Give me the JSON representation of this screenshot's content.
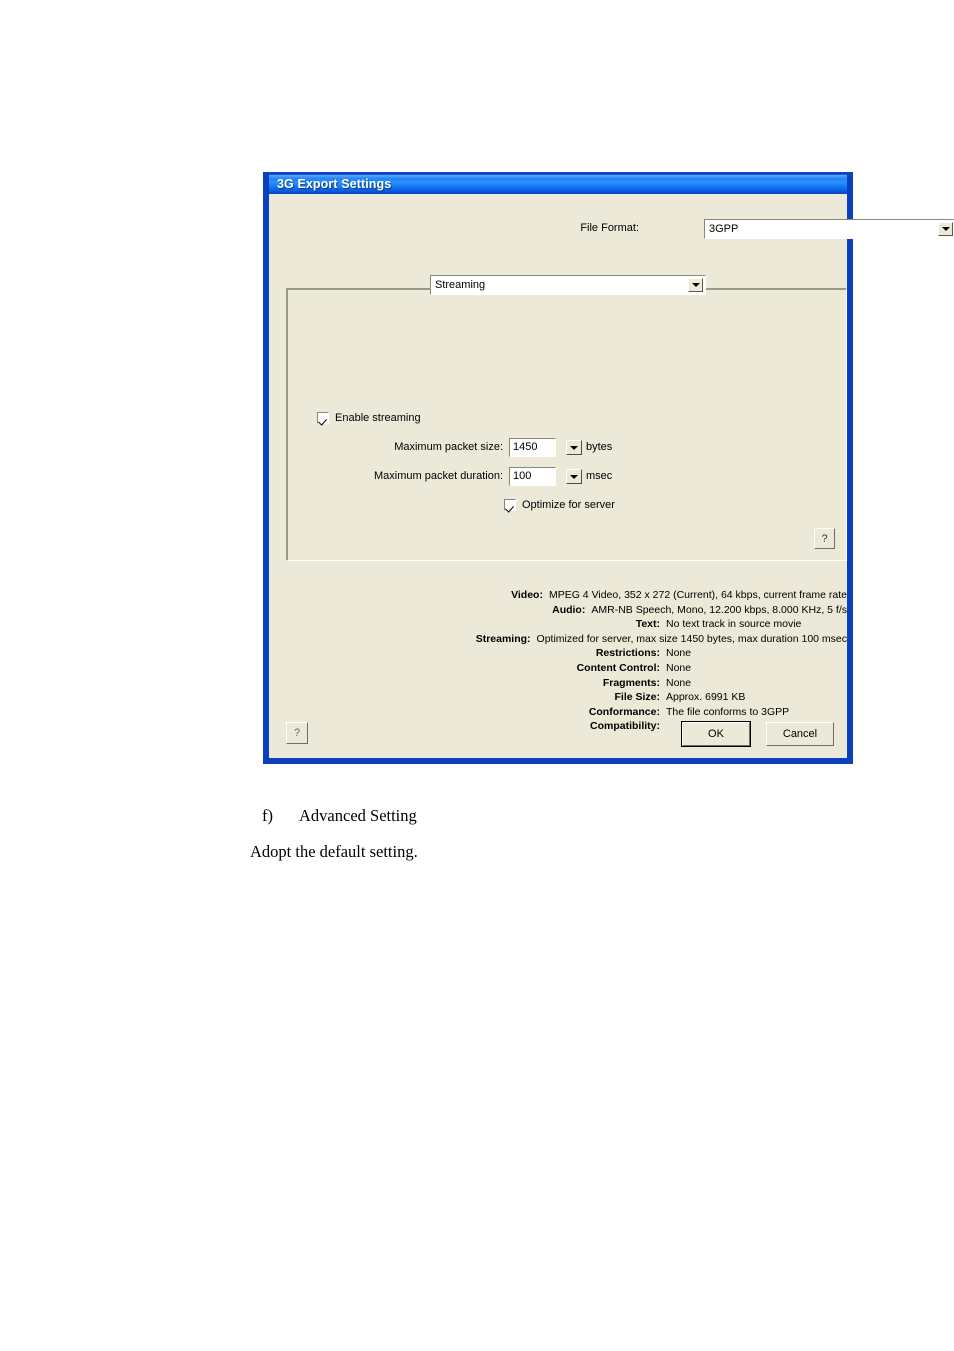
{
  "dialog": {
    "title": "3G Export Settings",
    "file_format": {
      "label": "File Format:",
      "value": "3GPP"
    },
    "panel_selector": {
      "value": "Streaming"
    },
    "streaming": {
      "enable_label": "Enable streaming",
      "enable_checked": true,
      "packet_size": {
        "label": "Maximum packet size:",
        "value": "1450",
        "unit": "bytes"
      },
      "packet_duration": {
        "label": "Maximum packet duration:",
        "value": "100",
        "unit": "msec"
      },
      "optimize_label": "Optimize for server",
      "optimize_checked": true
    },
    "panel_help_label": "?",
    "summary": [
      {
        "label": "Video:",
        "value": "MPEG 4 Video, 352 x 272 (Current), 64 kbps, current frame rate"
      },
      {
        "label": "Audio:",
        "value": "AMR-NB Speech, Mono, 12.200 kbps, 8.000 KHz, 5 f/s"
      },
      {
        "label": "Text:",
        "value": "No text track in source movie"
      },
      {
        "label": "Streaming:",
        "value": "Optimized for server, max size 1450 bytes, max duration 100 msec"
      },
      {
        "label": "Restrictions:",
        "value": "None"
      },
      {
        "label": "Content Control:",
        "value": "None"
      },
      {
        "label": "Fragments:",
        "value": "None"
      },
      {
        "label": "File Size:",
        "value": "Approx. 6991 KB"
      },
      {
        "label": "Conformance:",
        "value": "The file conforms to 3GPP"
      },
      {
        "label": "Compatibility:",
        "value": ""
      }
    ],
    "buttons": {
      "help_label": "?",
      "ok_label": "OK",
      "cancel_label": "Cancel"
    }
  },
  "caption": {
    "marker": "f)",
    "heading": "Advanced Setting",
    "body": "Adopt the default setting."
  },
  "colors": {
    "title_bar_blue": "#0a56d6",
    "dialog_face": "#ece9d8",
    "dialog_border": "#0a3fbd"
  }
}
